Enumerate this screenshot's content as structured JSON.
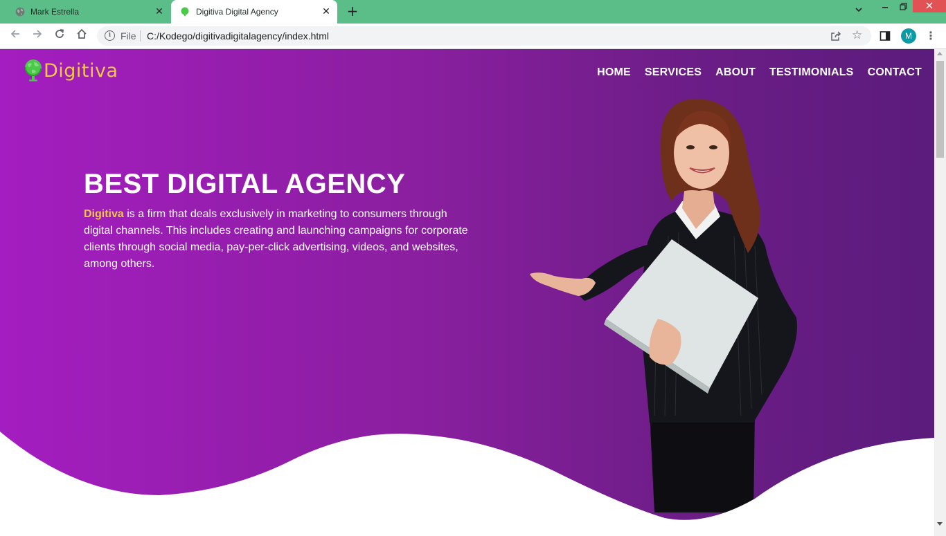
{
  "browser": {
    "tabs": [
      {
        "title": "Mark Estrella",
        "icon": "globe-icon",
        "active": false
      },
      {
        "title": "Digitiva Digital Agency",
        "icon": "site-favicon-icon",
        "active": true
      }
    ],
    "new_tab_label": "+",
    "address": {
      "security_label": "File",
      "url": "C:/Kodego/digitivadigitalagency/index.html"
    },
    "profile_initial": "M",
    "colors": {
      "tabbar": "#5bbd87",
      "close_button": "#e05254",
      "avatar": "#0c9aa6"
    }
  },
  "page": {
    "logo_text": "Digitiva",
    "nav": [
      "HOME",
      "SERVICES",
      "ABOUT",
      "TESTIMONIALS",
      "CONTACT"
    ],
    "headline": "BEST DIGITAL AGENCY",
    "intro_brand": "Digitiva",
    "intro_text": " is a firm that deals exclusively in marketing to consumers through digital channels. This includes creating and launching campaigns for corporate clients through social media, pay-per-click advertising, videos, and websites, among others.",
    "colors": {
      "hero_start": "#a41dc0",
      "hero_end": "#5b1c7c",
      "accent": "#f2c845",
      "logo_icon": "#4cc94a"
    }
  }
}
